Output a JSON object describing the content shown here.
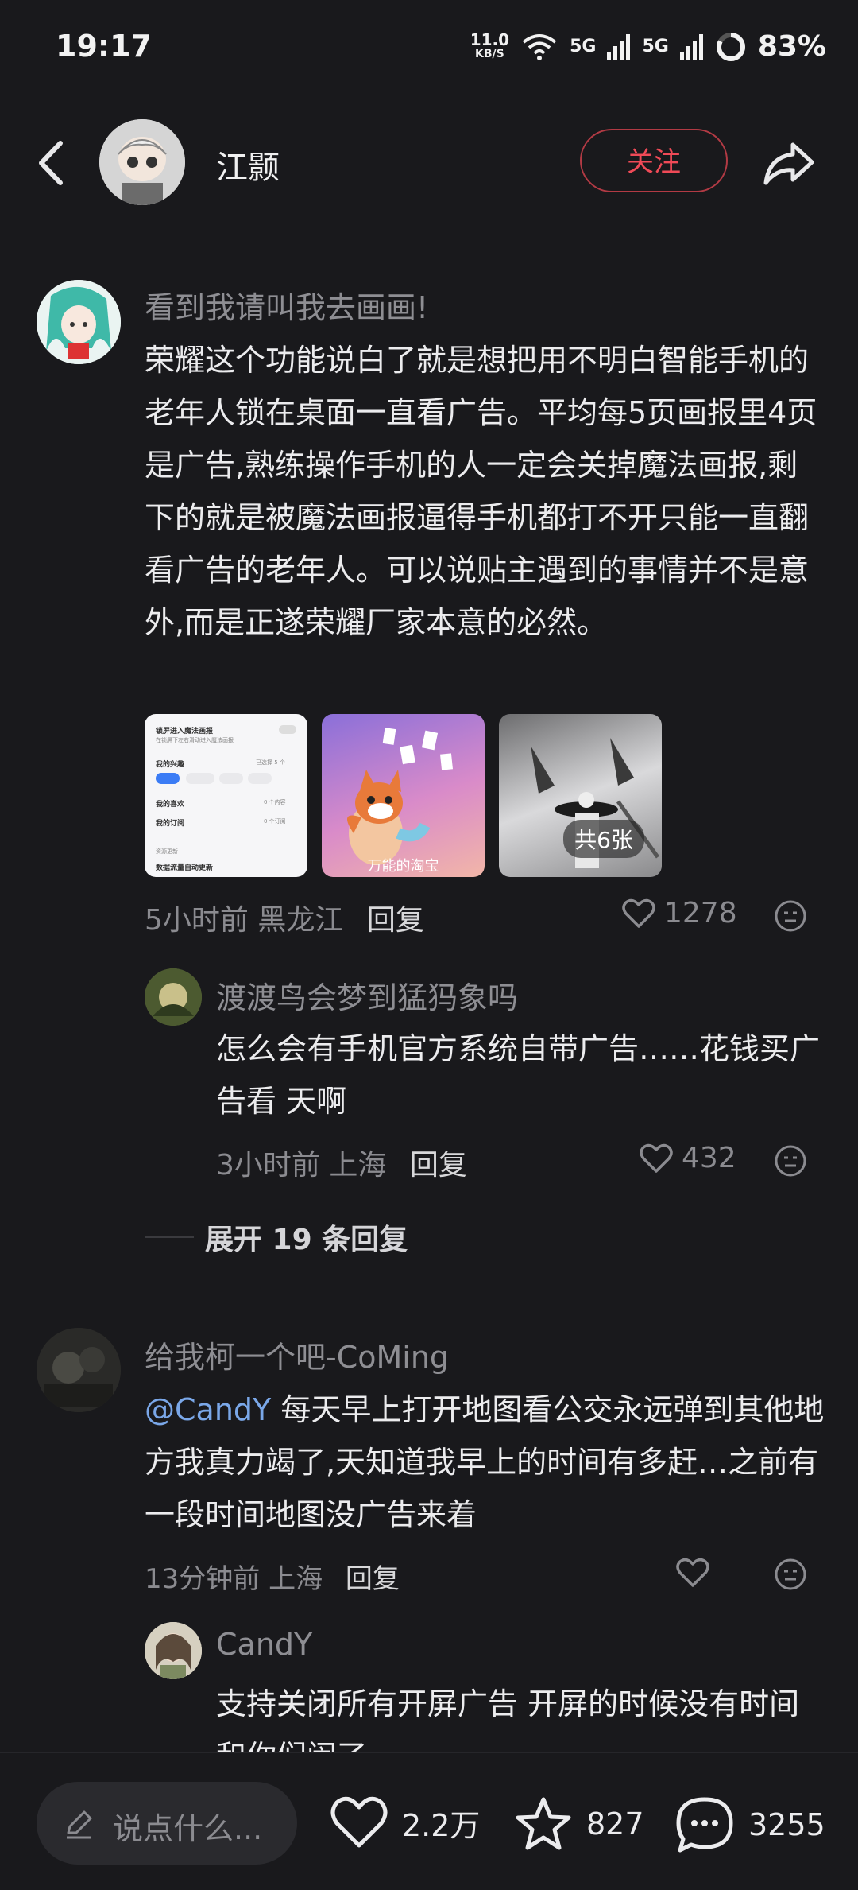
{
  "status": {
    "time": "19:17",
    "net_speed_top": "11.0",
    "net_speed_bottom": "KB/S",
    "signal1": "5G",
    "signal2": "5G",
    "battery": "83%"
  },
  "header": {
    "username": "江颢",
    "follow_label": "关注"
  },
  "comments": [
    {
      "name": "看到我请叫我去画画!",
      "text": "荣耀这个功能说白了就是想把用不明白智能手机的老年人锁在桌面一直看广告。平均每5页画报里4页是广告,熟练操作手机的人一定会关掉魔法画报,剩下的就是被魔法画报逼得手机都打不开只能一直翻看广告的老年人。可以说贴主遇到的事情并不是意外,而是正遂荣耀厂家本意的必然。",
      "time": "5小时前",
      "location": "黑龙江",
      "reply": "回复",
      "likes": "1278",
      "images": {
        "img1_lines": [
          "锁屏进入魔法画报",
          "在锁屏下左右滑动进入魔法画报",
          "我的兴趣",
          "已选择 5 个",
          "我的喜欢",
          "0 个内容",
          "我的订阅",
          "0 个订阅",
          "资源更新",
          "数据流量自动更新"
        ],
        "img2_caption": "万能的淘宝",
        "count_label": "共6张"
      },
      "sub": {
        "name": "渡渡鸟会梦到猛犸象吗",
        "text": "怎么会有手机官方系统自带广告……花钱买广告看 天啊",
        "time": "3小时前",
        "location": "上海",
        "reply": "回复",
        "likes": "432"
      },
      "expand": "展开 19 条回复"
    },
    {
      "name": "给我柯一个吧-CoMing",
      "mention": "@CandY",
      "text": " 每天早上打开地图看公交永远弹到其他地方我真力竭了,天知道我早上的时间有多赶…之前有一段时间地图没广告来着",
      "time": "13分钟前",
      "location": "上海",
      "reply": "回复",
      "sub": {
        "name": "CandY",
        "text": "支持关闭所有开屏广告 开屏的时候没有时间和你们闹了"
      }
    }
  ],
  "bottom": {
    "input_placeholder": "说点什么...",
    "likes": "2.2万",
    "favorites": "827",
    "comments": "3255"
  },
  "colors": {
    "background": "#19191c",
    "accent": "#f04a57",
    "mention": "#7aa7e8"
  }
}
